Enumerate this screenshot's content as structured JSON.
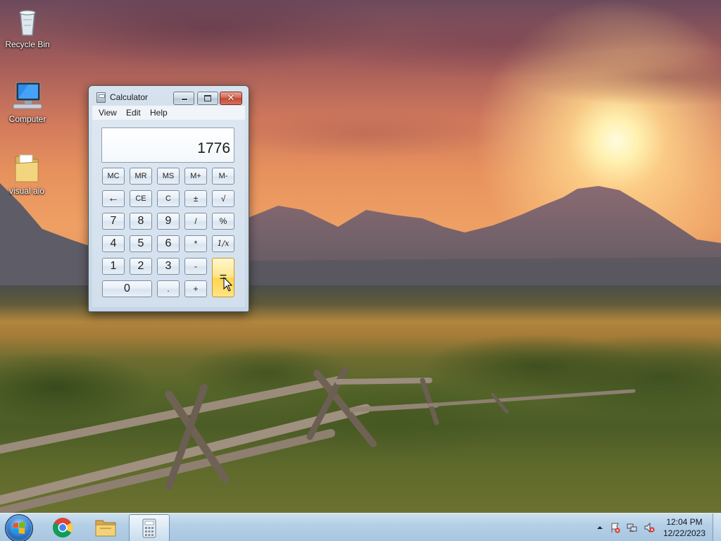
{
  "desktop": {
    "icons": [
      {
        "label": "Recycle Bin",
        "icon": "recycle-bin-icon"
      },
      {
        "label": "Computer",
        "icon": "computer-icon"
      },
      {
        "label": "visual aio",
        "icon": "folder-icon"
      }
    ]
  },
  "calculator": {
    "title": "Calculator",
    "menu": [
      "View",
      "Edit",
      "Help"
    ],
    "display": "1776",
    "rows": [
      [
        "MC",
        "MR",
        "MS",
        "M+",
        "M-"
      ],
      [
        "←",
        "CE",
        "C",
        "±",
        "√"
      ],
      [
        "7",
        "8",
        "9",
        "/",
        "%"
      ],
      [
        "4",
        "5",
        "6",
        "*",
        "1/x"
      ],
      [
        "1",
        "2",
        "3",
        "-",
        "="
      ],
      [
        "0",
        ".",
        "+"
      ]
    ]
  },
  "taskbar": {
    "start": "start-orb-icon",
    "pinned": [
      "chrome-icon",
      "file-explorer-icon",
      "calculator-icon"
    ],
    "active": "calculator",
    "tray": [
      "show-hidden-icons",
      "action-center-icon",
      "network-icon",
      "volume-muted-icon"
    ],
    "clock": {
      "time": "12:04 PM",
      "date": "12/22/2023"
    }
  },
  "colors": {
    "equals_key": "#ffd54d",
    "taskbar": "#b4cfe6",
    "close_button": "#c04a34"
  }
}
